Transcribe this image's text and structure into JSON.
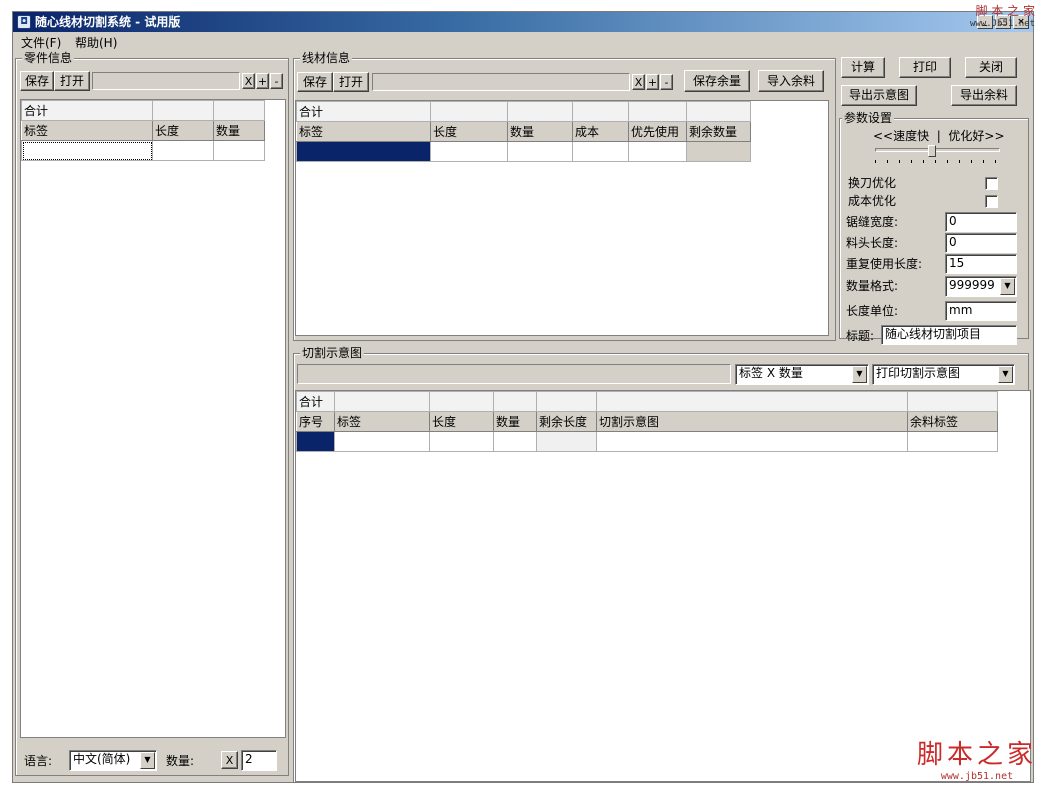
{
  "window": {
    "title": "随心线材切割系统 - 试用版"
  },
  "menu": {
    "items": [
      "文件(F)",
      "帮助(H)"
    ]
  },
  "parts": {
    "title": "零件信息",
    "save": "保存",
    "open": "打开",
    "x": "X",
    "plus": "+",
    "minus": "-",
    "total_label": "合计",
    "headers": [
      "标签",
      "长度",
      "数量"
    ],
    "language_label": "语言:",
    "language_value": "中文(简体)",
    "qty_label": "数量:",
    "qty_x": "X",
    "qty_value": "2"
  },
  "stock": {
    "title": "线材信息",
    "save": "保存",
    "open": "打开",
    "x": "X",
    "plus": "+",
    "minus": "-",
    "save_remnant": "保存余量",
    "import_remnant": "导入余料",
    "total_label": "合计",
    "headers": [
      "标签",
      "长度",
      "数量",
      "成本",
      "优先使用",
      "剩余数量"
    ]
  },
  "actions": {
    "calc": "计算",
    "print": "打印",
    "close": "关闭",
    "export_diagram": "导出示意图",
    "export_remnant": "导出余料"
  },
  "params": {
    "title": "参数设置",
    "speed_label": "<<速度快  |  优化好>>",
    "speed_level": 0.45,
    "tool_change": "换刀优化",
    "cost_opt": "成本优化",
    "kerf_label": "锯缝宽度:",
    "kerf_value": "0",
    "head_label": "料头长度:",
    "head_value": "0",
    "reuse_label": "重复使用长度:",
    "reuse_value": "15",
    "qty_format_label": "数量格式:",
    "qty_format_value": "999999",
    "unit_label": "长度单位:",
    "unit_value": "mm",
    "title_label": "标题:",
    "title_value": "随心线材切割项目"
  },
  "diagram": {
    "title": "切割示意图",
    "label_mode": "标签 X 数量",
    "print_mode": "打印切割示意图",
    "total_label": "合计",
    "headers": [
      "序号",
      "标签",
      "长度",
      "数量",
      "剩余长度",
      "切割示意图",
      "余料标签"
    ]
  },
  "watermark": {
    "top": "脚 本 之 家",
    "top_url": "www.Jb51.net",
    "bottom": "脚本之家",
    "bottom_url": "www.jb51.net"
  }
}
